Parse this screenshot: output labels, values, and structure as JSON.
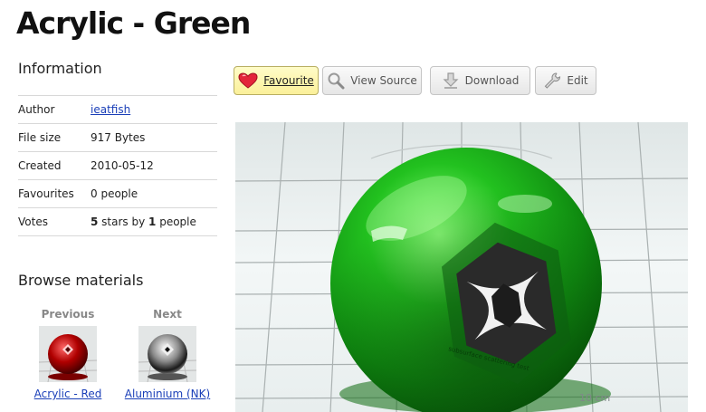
{
  "page": {
    "title": "Acrylic - Green"
  },
  "information": {
    "heading": "Information",
    "rows": [
      {
        "key": "Author",
        "value": "ieatfish"
      },
      {
        "key": "File size",
        "value": "917 Bytes"
      },
      {
        "key": "Created",
        "value": "2010-05-12"
      },
      {
        "key": "Favourites",
        "value": "0 people"
      },
      {
        "key": "Votes",
        "value_bold": "5",
        "value_mid": " stars by ",
        "value_bold2": "1",
        "value_end": " people"
      }
    ]
  },
  "browse": {
    "heading": "Browse materials",
    "previous": {
      "label": "Previous",
      "name": "Acrylic - Red"
    },
    "next": {
      "label": "Next",
      "name": "Aluminium (NK)"
    }
  },
  "toolbar": {
    "favourite": "Favourite",
    "view_source": "View Source",
    "download": "Download",
    "edit": "Edit"
  },
  "render": {
    "text": "subsurface scattering test",
    "scale_label": "10 cm"
  },
  "colors": {
    "accent_link": "#1a3fb8",
    "fav_bg": "#fbf09a",
    "sphere": "#1aa31a"
  },
  "icons": [
    "heart-icon",
    "magnifier-icon",
    "download-arrow-icon",
    "wrench-icon"
  ]
}
